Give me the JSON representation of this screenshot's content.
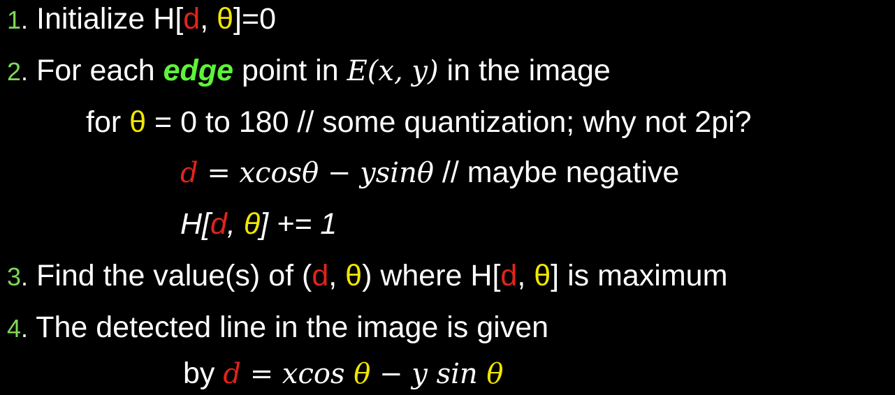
{
  "colors": {
    "background": "#000000",
    "step_number": "#7ed957",
    "d_symbol": "#e0241b",
    "theta_symbol": "#f2e600",
    "edge_highlight": "#5ff23a",
    "text": "#ffffff"
  },
  "steps": [
    {
      "number": "1",
      "dot": ".",
      "pre": " Initialize H[",
      "d": "d",
      "sep": ", ",
      "theta": "θ",
      "post": "]=0"
    },
    {
      "number": "2",
      "dot": ".",
      "pre": " For each ",
      "highlight": "edge",
      "mid": " point in ",
      "math": "E(x, y)",
      "post": " in the image"
    },
    {
      "pre": "for ",
      "theta": "θ",
      "post": " = 0 to 180  // some quantization; why not 2pi?"
    },
    {
      "d": "d",
      "eq": " = xcos",
      "theta": "θ",
      "mid": " − ysin",
      "theta2": "θ",
      "comment": "   // maybe negative"
    },
    {
      "pre": "H[",
      "d": "d",
      "sep": ", ",
      "theta": "θ",
      "post": "] += 1"
    },
    {
      "number": "3",
      "dot": ".",
      "pre": " Find the value(s) of (",
      "d": "d",
      "sep": ", ",
      "theta": "θ",
      "mid": ") where H[",
      "d2": "d",
      "sep2": ", ",
      "theta2": "θ",
      "post": "] is maximum"
    },
    {
      "number": "4",
      "dot": ".",
      "text": " The detected line in the image is given"
    },
    {
      "pre": "by ",
      "d": "d",
      "eq": " = xcos ",
      "theta": "θ",
      "mid": " − y sin ",
      "theta2": "θ"
    }
  ]
}
